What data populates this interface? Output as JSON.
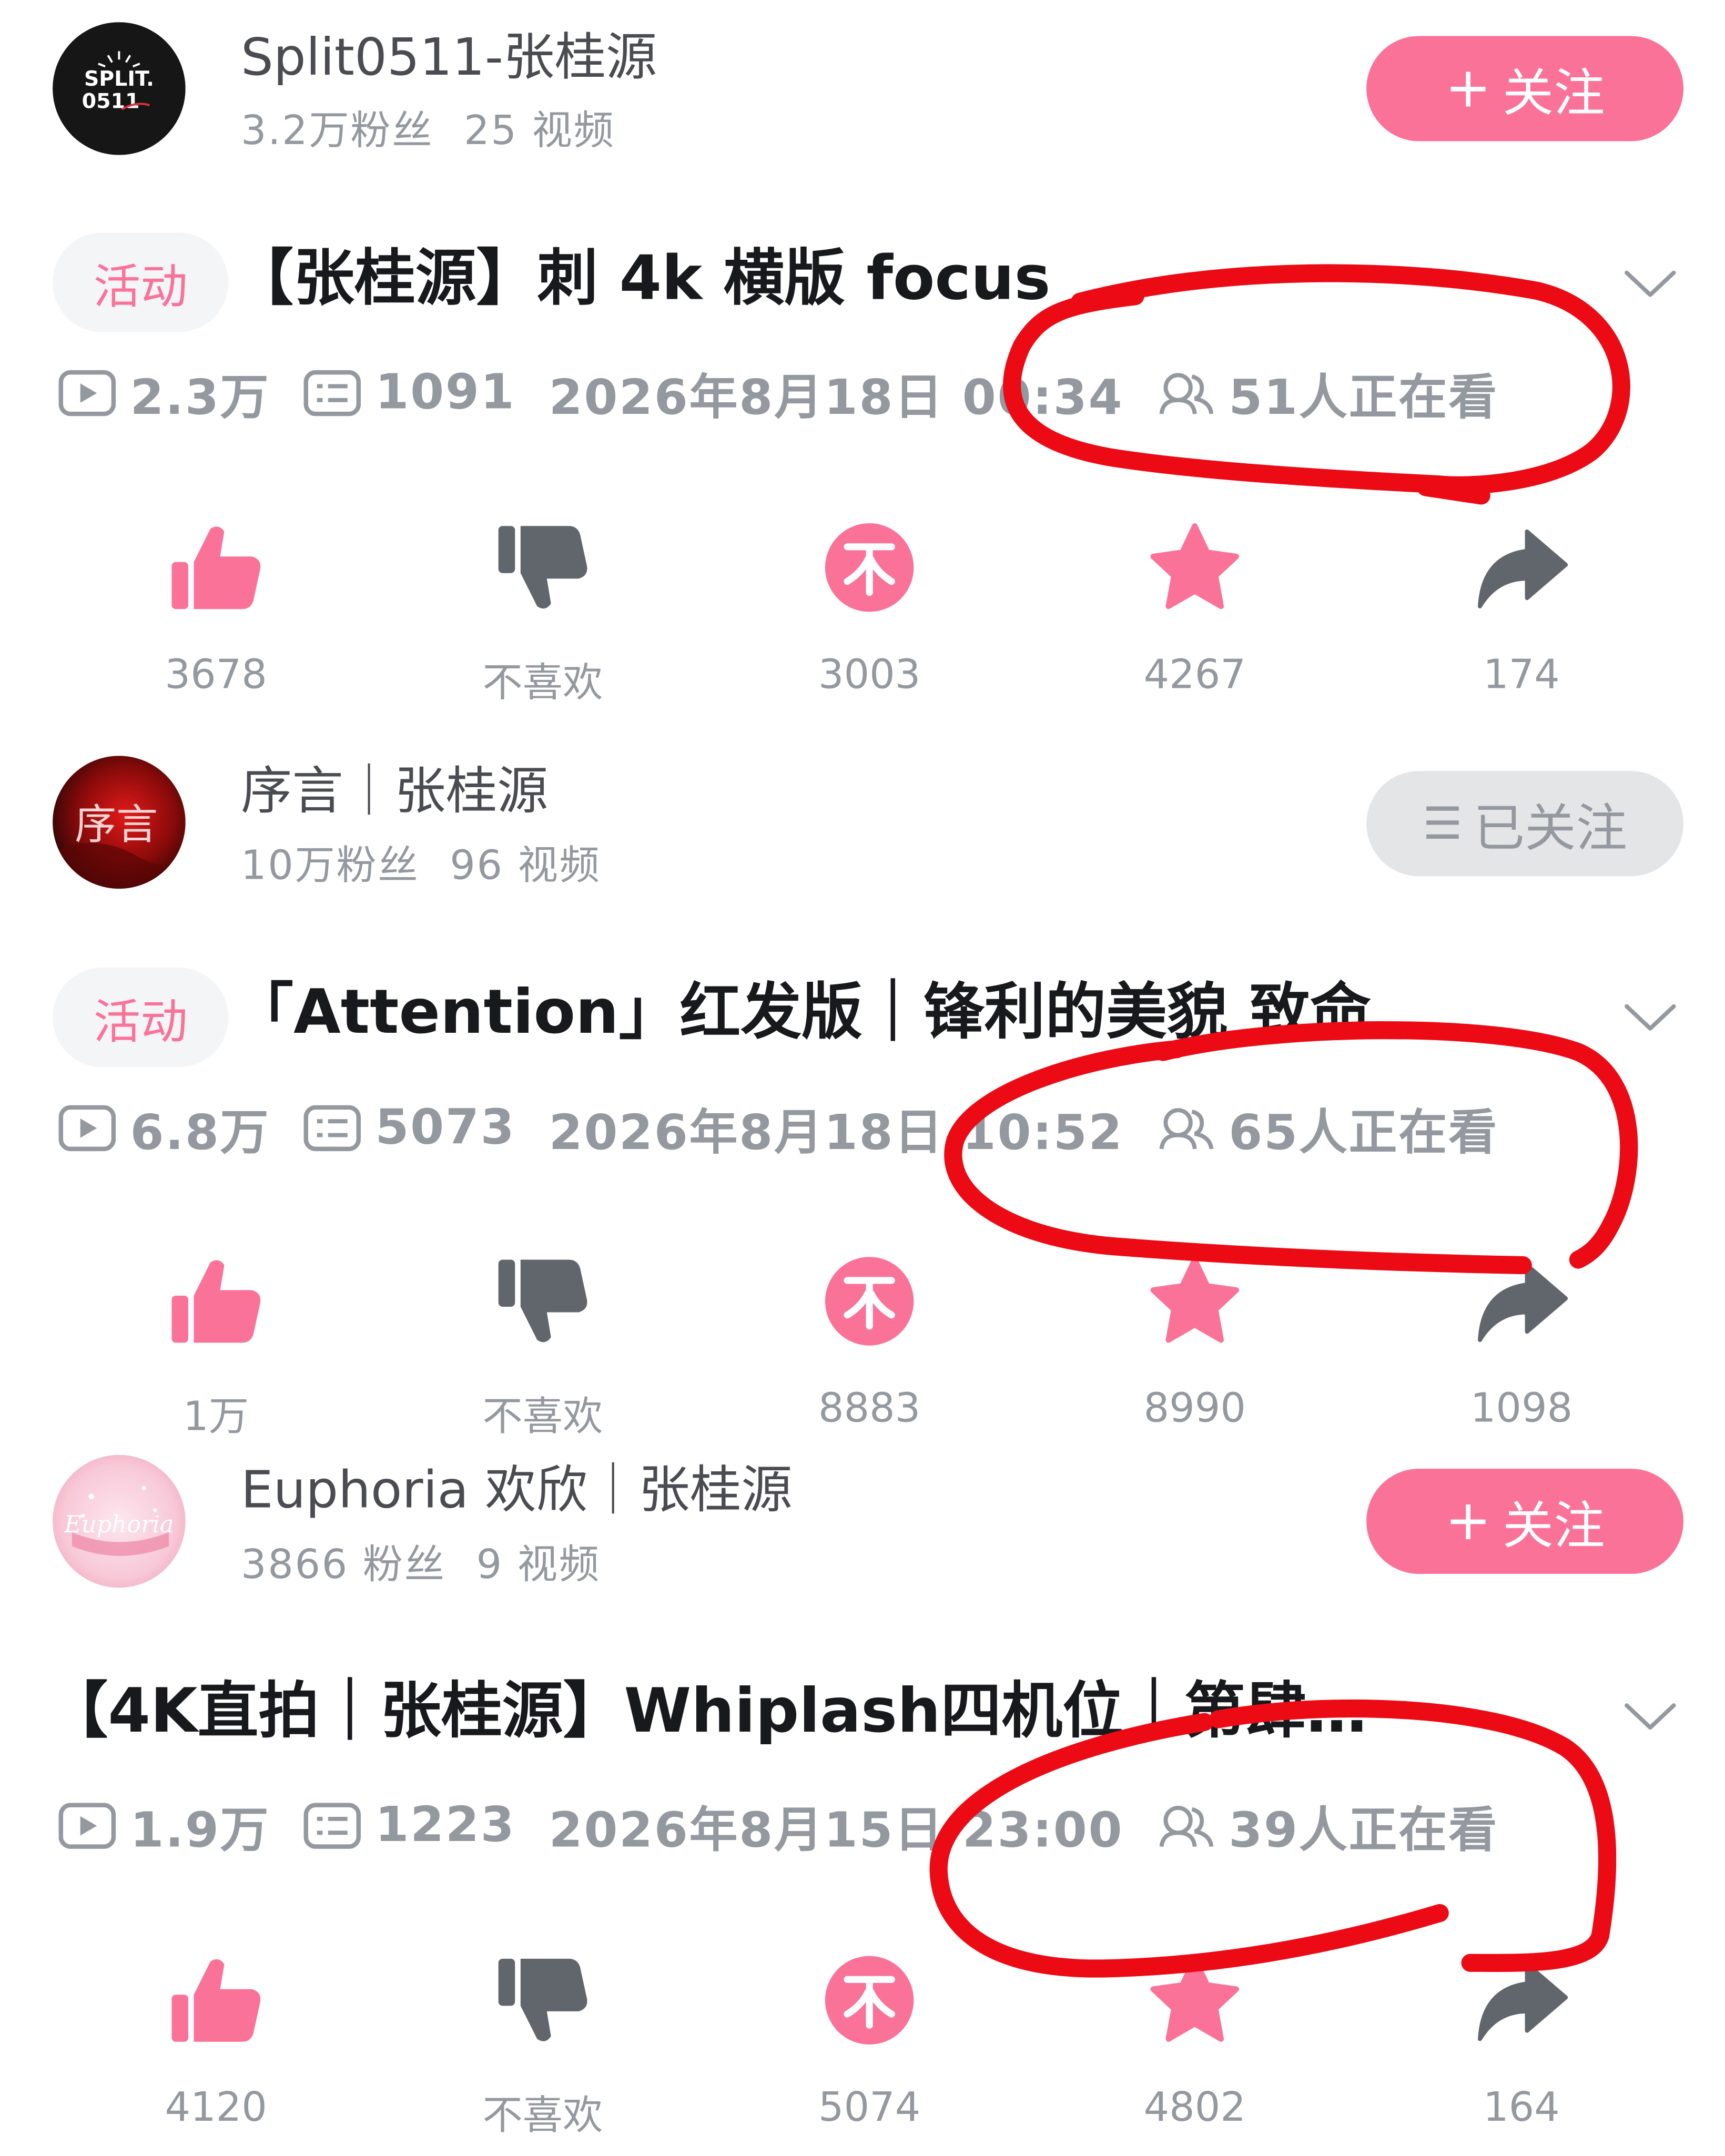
{
  "colors": {
    "accent": "#fb7299",
    "dislike": "#61666d",
    "muted": "#9499a0",
    "annotation": "#ec0a14"
  },
  "feed": [
    {
      "uploader": {
        "name": "Split0511-张桂源",
        "fans": "3.2万粉丝",
        "videos": "25 视频",
        "avatar_text": "SPLIT. 0511",
        "avatar_icon": "split0511-logo"
      },
      "follow": {
        "label": "关注",
        "prefix": "+",
        "state": "not-followed"
      },
      "video": {
        "badge": "活动",
        "title": "【张桂源】刺 4k 横版 focus",
        "views": "2.3万",
        "danmaku": "1091",
        "datetime": "2026年8月18日 00:34",
        "watching": "51人正在看"
      },
      "actions": {
        "like": "3678",
        "dislike": "不喜欢",
        "coin": "3003",
        "favorite": "4267",
        "share": "174"
      }
    },
    {
      "uploader": {
        "name": "序言｜张桂源",
        "fans": "10万粉丝",
        "videos": "96 视频",
        "avatar_text": "序言",
        "avatar_icon": "red-preface-avatar"
      },
      "follow": {
        "label": "已关注",
        "prefix": "☰",
        "state": "followed"
      },
      "video": {
        "badge": "活动",
        "title": "「Attention」红发版｜锋利的美貌 致命",
        "views": "6.8万",
        "danmaku": "5073",
        "datetime": "2026年8月18日 10:52",
        "watching": "65人正在看"
      },
      "actions": {
        "like": "1万",
        "dislike": "不喜欢",
        "coin": "8883",
        "favorite": "8990",
        "share": "1098"
      }
    },
    {
      "uploader": {
        "name": "Euphoria 欢欣｜张桂源",
        "fans": "3866 粉丝",
        "videos": "9 视频",
        "avatar_text": "Euphoria",
        "avatar_icon": "pink-euphoria-avatar"
      },
      "follow": {
        "label": "关注",
        "prefix": "+",
        "state": "not-followed"
      },
      "video": {
        "badge": "",
        "title": "【4K直拍｜张桂源】Whiplash四机位｜第肆…",
        "views": "1.9万",
        "danmaku": "1223",
        "datetime": "2026年8月15日 23:00",
        "watching": "39人正在看"
      },
      "actions": {
        "like": "4120",
        "dislike": "不喜欢",
        "coin": "5074",
        "favorite": "4802",
        "share": "164"
      }
    }
  ],
  "icons": {
    "views": "play-count-icon",
    "danmaku": "danmaku-icon",
    "watching": "viewers-icon",
    "like": "thumbs-up-icon",
    "dislike": "thumbs-down-icon",
    "coin": "coin-icon",
    "favorite": "star-icon",
    "share": "share-arrow-icon",
    "expand": "chevron-down-icon"
  }
}
